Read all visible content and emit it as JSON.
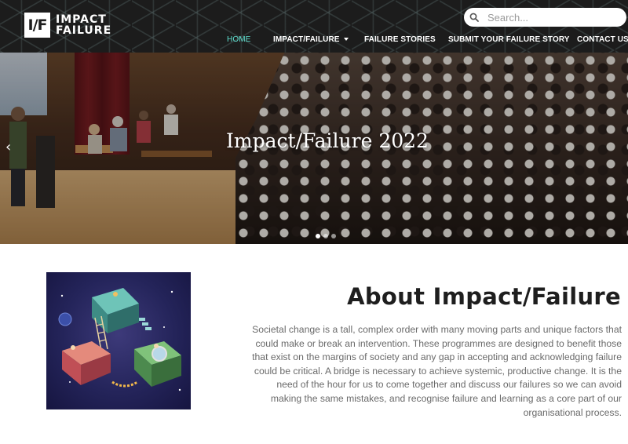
{
  "logo": {
    "mark": "I/F",
    "line1": "IMPACT",
    "line2": "FAILURE"
  },
  "search": {
    "placeholder": "Search..."
  },
  "nav": {
    "items": [
      {
        "label": "HOME",
        "active": true
      },
      {
        "label": "IMPACT/FAILURE",
        "has_dropdown": true
      },
      {
        "label": "FAILURE STORIES"
      },
      {
        "label": "SUBMIT YOUR FAILURE STORY"
      },
      {
        "label": "CONTACT US"
      }
    ]
  },
  "hero": {
    "title": "Impact/Failure 2022",
    "prev_icon": "chevron-left-icon",
    "slides": 3,
    "active_slide": 1
  },
  "about": {
    "title": "About Impact/Failure",
    "body": "Societal change is a tall, complex order with many moving parts and unique factors that could make or break an intervention. These programmes are designed to benefit those that exist on the margins of society and any gap in accepting and acknowledging failure could be critical. A bridge is necessary to achieve systemic, productive change. It is the need of the hour for us to come together and discuss our failures so we can avoid making the same mistakes, and recognise failure and learning as a core part of our organisational process."
  },
  "colors": {
    "header_bg": "#1c1c1c",
    "nav_active": "#5fe0d0",
    "heading": "#1e1e1e",
    "body_text": "#6a6a6a"
  }
}
